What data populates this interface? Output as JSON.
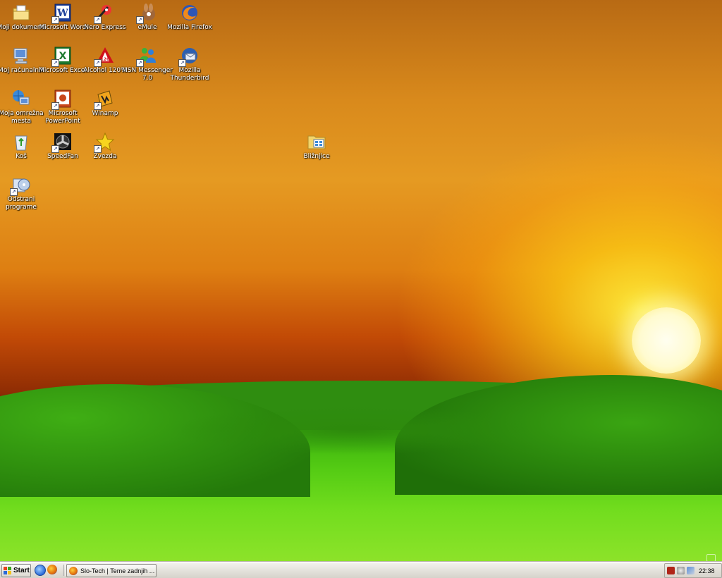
{
  "desktop": {
    "icons": [
      {
        "label": "Moji dokumenti",
        "icon": "documents-folder-icon"
      },
      {
        "label": "Microsoft Word",
        "icon": "word-icon"
      },
      {
        "label": "Nero Express",
        "icon": "nero-icon"
      },
      {
        "label": "eMule",
        "icon": "emule-icon"
      },
      {
        "label": "Mozilla Firefox",
        "icon": "firefox-icon"
      },
      {
        "label": "Moj računalnik",
        "icon": "computer-icon"
      },
      {
        "label": "Microsoft Excel",
        "icon": "excel-icon"
      },
      {
        "label": "Alcohol 120%",
        "icon": "alcohol-icon"
      },
      {
        "label": "MSN Messenger 7.0",
        "icon": "msn-icon"
      },
      {
        "label": "Mozilla Thunderbird",
        "icon": "thunderbird-icon"
      },
      {
        "label": "Moja omrežna mesta",
        "icon": "network-places-icon"
      },
      {
        "label": "Microsoft PowerPoint",
        "icon": "powerpoint-icon"
      },
      {
        "label": "Winamp",
        "icon": "winamp-icon"
      },
      {
        "label": "Koš",
        "icon": "recycle-bin-icon"
      },
      {
        "label": "SpeedFan",
        "icon": "speedfan-icon"
      },
      {
        "label": "Zvezda",
        "icon": "star-icon"
      },
      {
        "label": "Bližnjice",
        "icon": "shortcuts-folder-icon"
      },
      {
        "label": "Odstrani programe",
        "icon": "uninstall-programs-icon"
      }
    ]
  },
  "taskbar": {
    "start_label": "Start",
    "quick_launch": [
      "internet-explorer-icon",
      "firefox-icon"
    ],
    "task_button_label": "Slo-Tech | Teme zadnjih ...",
    "tray_icons": [
      "speedfan-tray-icon",
      "volume-icon",
      "network-icon"
    ],
    "clock": "22:38"
  },
  "colors": {
    "sky_top": "#b86a14",
    "sky_glow": "#ffd214",
    "grass": "#55cc14",
    "taskbar": "#d6d3cb"
  }
}
